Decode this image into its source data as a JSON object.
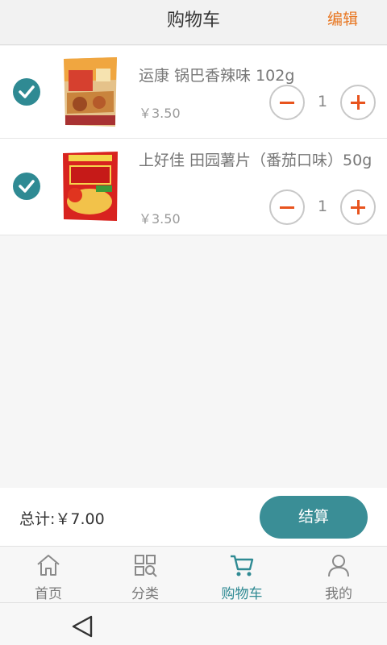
{
  "header": {
    "title": "购物车",
    "edit_label": "编辑"
  },
  "cart": {
    "items": [
      {
        "name": "运康 锅巴香辣味 102g",
        "price": "￥3.50",
        "quantity": "1",
        "selected": true
      },
      {
        "name": "上好佳 田园薯片（番茄口味）50g",
        "price": "￥3.50",
        "quantity": "1",
        "selected": true
      }
    ]
  },
  "footer": {
    "total_text": "总计:￥7.00",
    "checkout_label": "结算"
  },
  "tabs": [
    {
      "label": "首页",
      "icon": "home-icon"
    },
    {
      "label": "分类",
      "icon": "category-icon"
    },
    {
      "label": "购物车",
      "icon": "cart-icon",
      "active": true
    },
    {
      "label": "我的",
      "icon": "user-icon"
    }
  ],
  "colors": {
    "accent": "#2f8a93",
    "edit": "#e87722",
    "qty_icon": "#e8541e"
  }
}
